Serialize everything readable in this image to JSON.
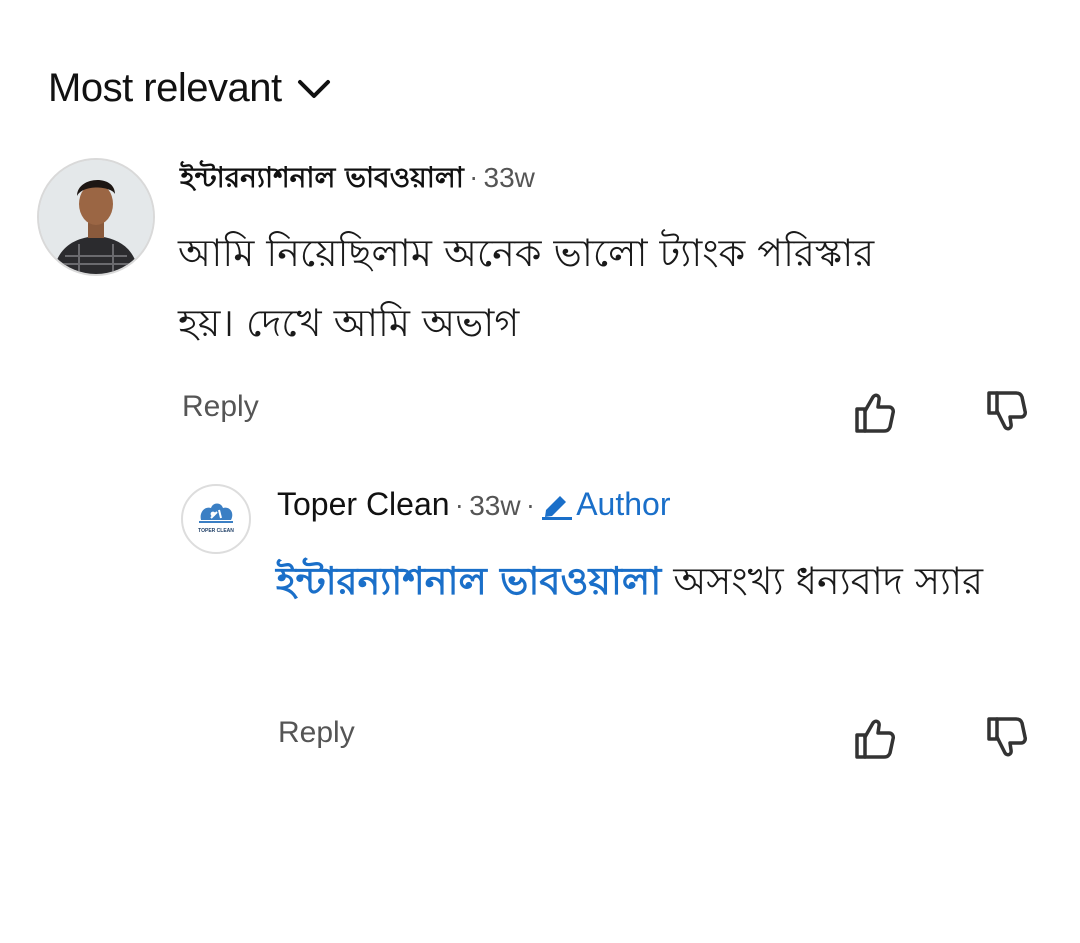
{
  "sort": {
    "label": "Most relevant",
    "chevron_icon": "chevron-down-icon"
  },
  "comments": [
    {
      "author": "ইন্টারন্যাশনাল ভাবওয়ালা",
      "dot": "·",
      "time": "33w",
      "text": "আমি নিয়েছিলাম অনেক ভালো ট্যাংক পরিস্কার হয়। দেখে আমি অভাগ",
      "reply_label": "Reply",
      "like_icon": "thumbs-up-icon",
      "dislike_icon": "thumbs-down-icon"
    }
  ],
  "replies": [
    {
      "author": "Toper Clean",
      "dot": "·",
      "time": "33w",
      "dot2": "·",
      "badge": "Author",
      "badge_icon": "pencil-icon",
      "logo_text": "TOPER CLEAN",
      "mention": "ইন্টারন্যাশনাল ভাবওয়ালা",
      "text": " অসংখ্য ধন্যবাদ স্যার",
      "reply_label": "Reply",
      "like_icon": "thumbs-up-icon",
      "dislike_icon": "thumbs-down-icon"
    }
  ],
  "colors": {
    "link_blue": "#1a6fc9",
    "muted_text": "#555555",
    "primary_text": "#111111"
  }
}
